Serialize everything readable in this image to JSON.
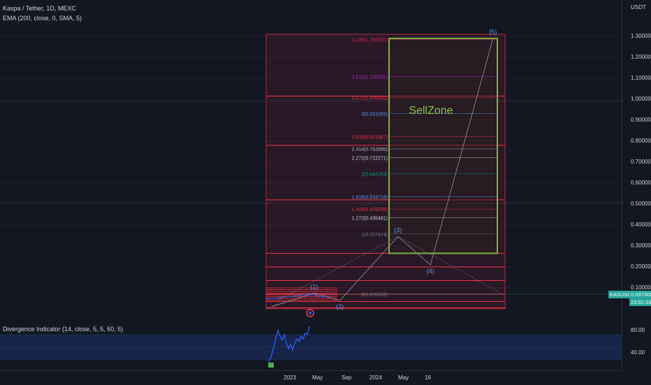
{
  "legend": {
    "title": "Kaspa / Tether, 1D, MEXC",
    "ema": "EMA (200, close, 0, SMA, 5)",
    "divergence": "Divergence Indicator (14, close, 5, 5, 60, 5)"
  },
  "price_axis": {
    "currency": "USDT",
    "ticks": [
      "1.300000",
      "1.200000",
      "1.100000",
      "1.000000",
      "0.900000",
      "0.800000",
      "0.700000",
      "0.600000",
      "0.500000",
      "0.400000",
      "0.300000",
      "0.200000",
      "0.100000"
    ],
    "symbol_badge": "KASUSDT",
    "price_badge": "0.037300",
    "time_badge": "23:02:33"
  },
  "osc_axis": {
    "ticks": [
      "80.00",
      "40.00"
    ]
  },
  "time_axis": {
    "ticks": [
      "2023",
      "May",
      "Sep",
      "2024",
      "May",
      "16"
    ]
  },
  "fib_levels": [
    {
      "label": "4.236(1.285520)",
      "price": 1.28552,
      "color": "#e91e63"
    },
    {
      "label": "3.618(1.108291)",
      "price": 1.108291,
      "color": "#9c27b0"
    },
    {
      "label": "3.272(1.009082)",
      "price": 1.009082,
      "color": "#f23645"
    },
    {
      "label": "3(0.931055)",
      "price": 0.931055,
      "color": "#5b9cf6"
    },
    {
      "label": "2.618(0.821507)",
      "price": 0.821507,
      "color": "#f23645"
    },
    {
      "label": "2.414(0.762995)",
      "price": 0.762995,
      "color": "#b2b5be"
    },
    {
      "label": "2.272(0.722271)",
      "price": 0.722271,
      "color": "#d1d4dc"
    },
    {
      "label": "2(0.644264)",
      "price": 0.644264,
      "color": "#089981"
    },
    {
      "label": "1.618(0.534718)",
      "price": 0.534718,
      "color": "#5b9cf6"
    },
    {
      "label": "1.414(0.476205)",
      "price": 0.476205,
      "color": "#f23645"
    },
    {
      "label": "1.272(0.435481)",
      "price": 0.435481,
      "color": "#d1d4dc"
    },
    {
      "label": "1(0.357474)",
      "price": 0.357474,
      "color": "#787b86"
    },
    {
      "label": "0(0.070653)",
      "price": 0.070653,
      "color": "#787b86"
    }
  ],
  "sell_zone": {
    "label": "SellZone",
    "top": 1.29,
    "bottom": 0.265
  },
  "waves": [
    {
      "label": "(1)",
      "price": 0.075,
      "t": 0.43
    },
    {
      "label": "(2)",
      "price": 0.04,
      "t": 0.66
    },
    {
      "label": "(3)",
      "price": 0.345,
      "t": 1.18
    },
    {
      "label": "(4)",
      "price": 0.21,
      "t": 1.47
    },
    {
      "label": "(5)",
      "price": 1.29,
      "t": 2.03
    }
  ],
  "colors": {
    "background": "#131722",
    "fib_zone": "#5c1e2e",
    "red_line": "#f23645",
    "sell_zone_border": "#7cb342",
    "sell_zone_text": "#8bc34a",
    "wave_label": "#5b9cf6",
    "price_line": "#2962ff",
    "badge_bg": "#26a69a"
  }
}
